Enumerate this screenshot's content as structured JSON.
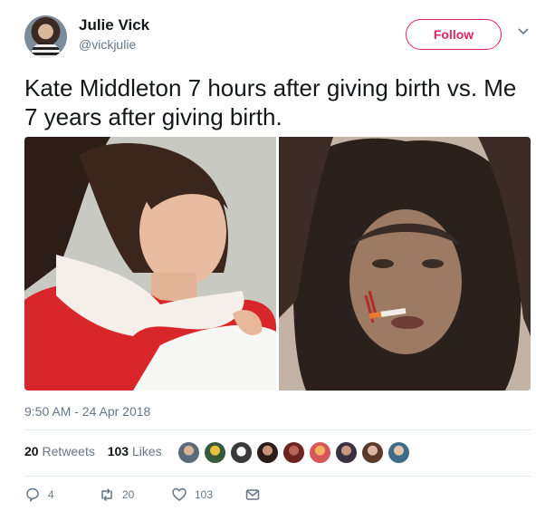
{
  "user": {
    "name": "Julie Vick",
    "handle": "@vickjulie",
    "follow_label": "Follow"
  },
  "tweet": {
    "text": "Kate Middleton 7 hours after giving birth vs. Me 7 years after giving birth.",
    "timestamp": "9:50 AM - 24 Apr 2018"
  },
  "stats": {
    "retweets_count": "20",
    "retweets_label": "Retweets",
    "likes_count": "103",
    "likes_label": "Likes"
  },
  "actions": {
    "reply_count": "4",
    "retweet_count": "20",
    "like_count": "103"
  },
  "colors": {
    "follow_accent": "#e0245e",
    "secondary_text": "#657786"
  },
  "icons": [
    "chevron-down-icon",
    "reply-icon",
    "retweet-icon",
    "heart-icon",
    "message-icon"
  ]
}
